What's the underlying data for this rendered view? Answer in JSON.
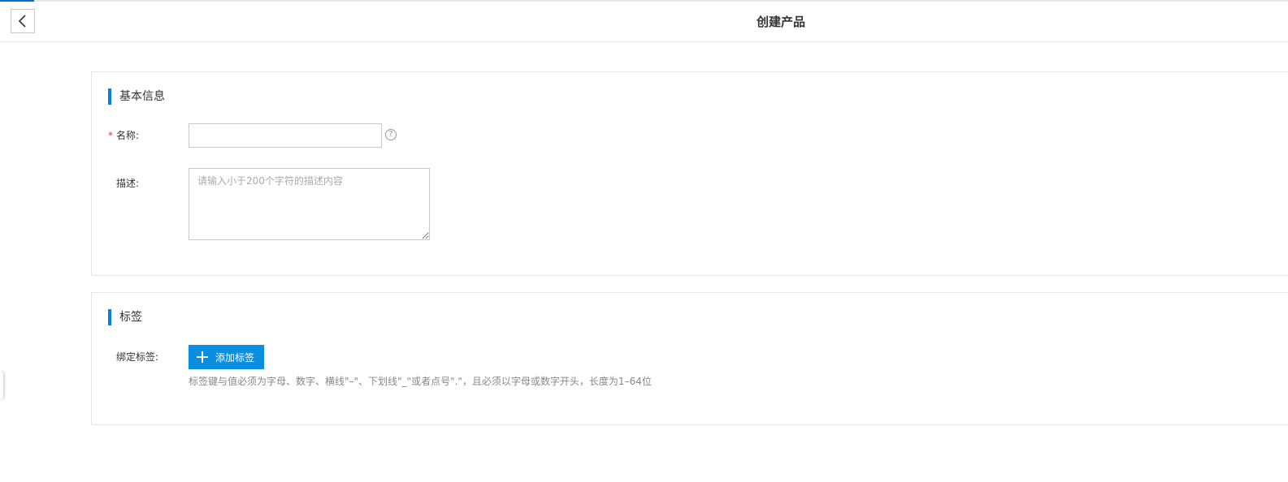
{
  "header": {
    "title": "创建产品",
    "back_icon": "chevron-left-icon"
  },
  "basic_info": {
    "section_title": "基本信息",
    "name": {
      "required_mark": "*",
      "label": "名称:",
      "value": "",
      "help_icon": "question-circle-icon",
      "help_glyph": "?"
    },
    "description": {
      "label": "描述:",
      "placeholder": "请输入小于200个字符的描述内容",
      "value": ""
    }
  },
  "tags": {
    "section_title": "标签",
    "bind_label": "绑定标签:",
    "add_button_label": "添加标签",
    "add_icon": "plus-icon",
    "hint": "标签键与值必须为字母、数字、横线\"–\"、下划线\"_\"或者点号\".\"，且必须以字母或数字开头，长度为1–64位"
  },
  "colors": {
    "accent": "#0a8fe0",
    "section_bar": "#0a7ed8",
    "required": "#e4393c"
  }
}
